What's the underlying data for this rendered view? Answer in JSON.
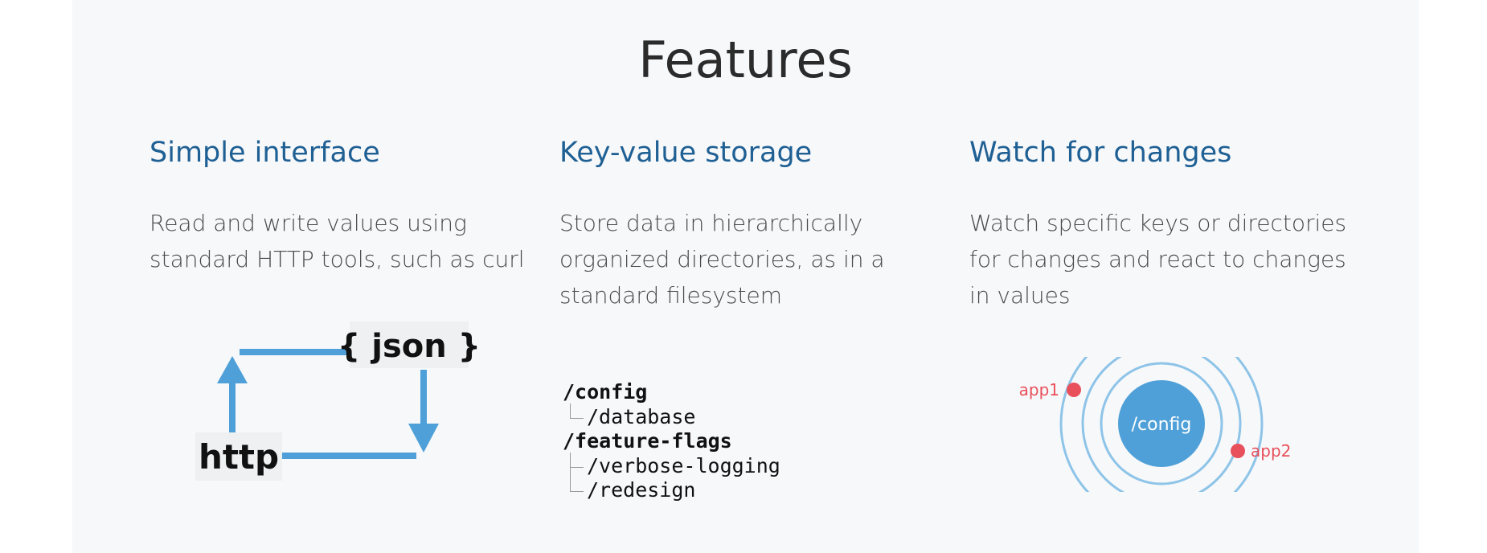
{
  "title": "Features",
  "features": [
    {
      "title": "Simple interface",
      "description": "Read and write values using standard HTTP tools, such as curl",
      "diagram": {
        "json_label": "{ json }",
        "http_label": "http"
      }
    },
    {
      "title": "Key-value storage",
      "description": "Store data in hierarchically organized directories, as in a standard filesystem",
      "tree": {
        "root1": "/config",
        "root1_children": [
          "/database"
        ],
        "root2": "/feature-flags",
        "root2_children": [
          "/verbose-logging",
          "/redesign"
        ]
      }
    },
    {
      "title": "Watch for changes",
      "description": "Watch specific keys or directories for changes and react to changes in values",
      "diagram": {
        "center_label": "/config",
        "app1": "app1",
        "app2": "app2"
      }
    }
  ],
  "colors": {
    "accent": "#4fa0d8",
    "ring": "#8ec4e8",
    "app": "#e8505b",
    "heading": "#1f6094"
  }
}
